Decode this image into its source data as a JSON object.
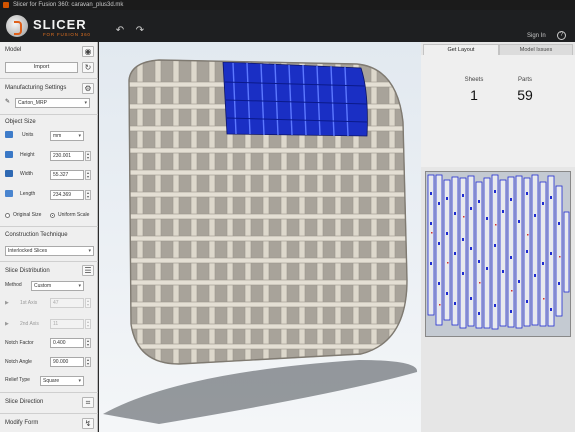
{
  "window": {
    "title": "Slicer for Fusion 360: caravan_plus3d.mk"
  },
  "header": {
    "brand": "SLICER",
    "subtitle": "FOR FUSION 360",
    "sign_in": "Sign In",
    "help": "?"
  },
  "left_panel": {
    "model_label": "Model",
    "import_label": "Import",
    "mfg_settings_label": "Manufacturing Settings",
    "material": "Carton_MRP",
    "object_size_label": "Object Size",
    "units_label": "Units",
    "units_value": "mm",
    "height_label": "Height",
    "height_value": "230.001",
    "width_label": "Width",
    "width_value": "55.327",
    "length_label": "Length",
    "length_value": "234.369",
    "original_size_label": "Original Size",
    "uniform_scale_label": "Uniform Scale",
    "construction_label": "Construction Technique",
    "construction_value": "Interlocked Slices",
    "slice_dist_label": "Slice Distribution",
    "method_label": "Method",
    "method_value": "Custom",
    "first_axis_label": "1st Axis",
    "first_axis_value": "47",
    "second_axis_label": "2nd Axis",
    "second_axis_value": "11",
    "notch_factor_label": "Notch Factor",
    "notch_factor_value": "0.400",
    "notch_angle_label": "Notch Angle",
    "notch_angle_value": "90.000",
    "relief_label": "Relief Type",
    "relief_value": "Square",
    "slice_direction_label": "Slice Direction",
    "modify_form_label": "Modify Form"
  },
  "right_panel": {
    "tab_get_layout": "Get Layout",
    "tab_model_issues": "Model Issues",
    "sheets_label": "Sheets",
    "sheets_value": "1",
    "parts_label": "Parts",
    "parts_value": "59"
  },
  "colors": {
    "accent": "#e07020",
    "slice_fill": "#d8d2c6",
    "selected_slice": "#1a2fc4",
    "sheet_bg": "#9aa3ad"
  },
  "icons": {
    "undo": "undo-arrow-icon",
    "redo": "redo-arrow-icon",
    "eye": "eye-icon",
    "refresh": "refresh-icon",
    "gear": "gear-icon",
    "pencil": "pencil-icon",
    "list": "list-icon",
    "grid": "grid-icon",
    "form": "modify-form-icon"
  }
}
